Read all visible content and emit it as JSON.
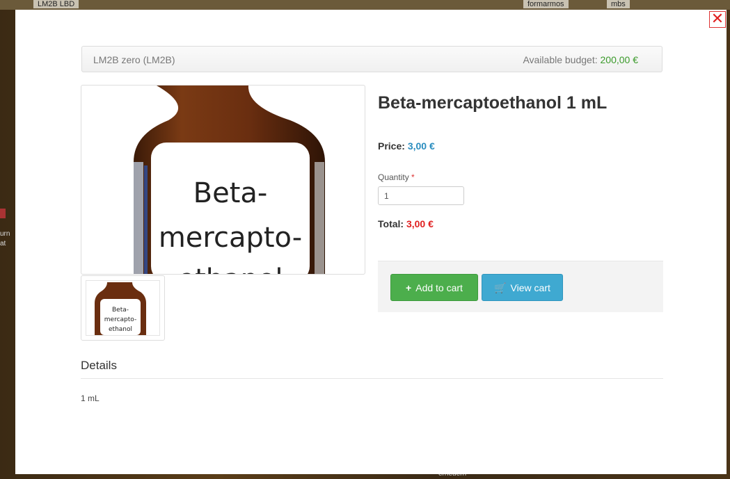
{
  "background": {
    "top_labels": [
      "LM2B LBD",
      "formarmos",
      "mbs"
    ],
    "left_text": "urn at",
    "bottom_text": "erneuern"
  },
  "modal": {
    "close_icon": "close-icon",
    "budget_bar": {
      "account": "LM2B zero (LM2B)",
      "budget_label": "Available budget:",
      "budget_value": "200,00 €"
    },
    "product": {
      "title": "Beta-mercaptoethanol 1 mL",
      "price_label": "Price:",
      "price_value": "3,00 €",
      "quantity_label": "Quantity",
      "quantity_required_mark": "*",
      "quantity_value": "1",
      "total_label": "Total:",
      "total_value": "3,00 €",
      "image_label_lines": [
        "Beta-",
        "mercapto-",
        "ethanol"
      ],
      "thumb_label_lines": [
        "Beta-",
        "mercapto-",
        "ethanol"
      ]
    },
    "actions": {
      "add_to_cart": "Add to cart",
      "add_icon": "plus-icon",
      "view_cart": "View cart",
      "view_icon": "cart-icon"
    },
    "details": {
      "heading": "Details",
      "body": "1 mL"
    }
  },
  "colors": {
    "price": "#2a8dbf",
    "total": "#e02020",
    "budget": "#3a9a2a",
    "add_button": "#4cae4c",
    "view_button": "#3fa9d1"
  }
}
